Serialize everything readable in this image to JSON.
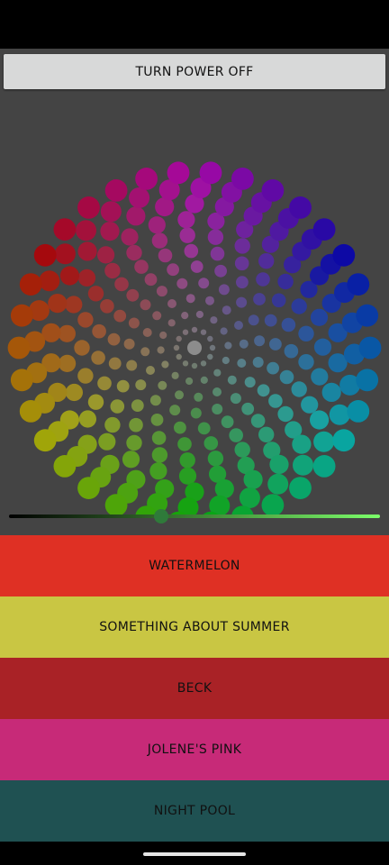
{
  "power_button": {
    "label": "TURN POWER OFF"
  },
  "wheel": {
    "center_color": "#8c8c8c"
  },
  "brightness": {
    "value": 0.41,
    "track_start_color": "#000000",
    "track_end_color": "#7cff6a",
    "thumb_color": "#2f7a3a"
  },
  "presets": [
    {
      "label": "WATERMELON",
      "color": "#df3024"
    },
    {
      "label": "SOMETHING ABOUT SUMMER",
      "color": "#c9c643"
    },
    {
      "label": "BECK",
      "color": "#a92226"
    },
    {
      "label": "JOLENE'S PINK",
      "color": "#c72a78"
    },
    {
      "label": "NIGHT POOL",
      "color": "#1f5152"
    }
  ],
  "colors": {
    "status_bar": "#000000",
    "panel_background": "#444444",
    "button_background": "#d8d9d9",
    "home_indicator": "#e6e6e6"
  }
}
